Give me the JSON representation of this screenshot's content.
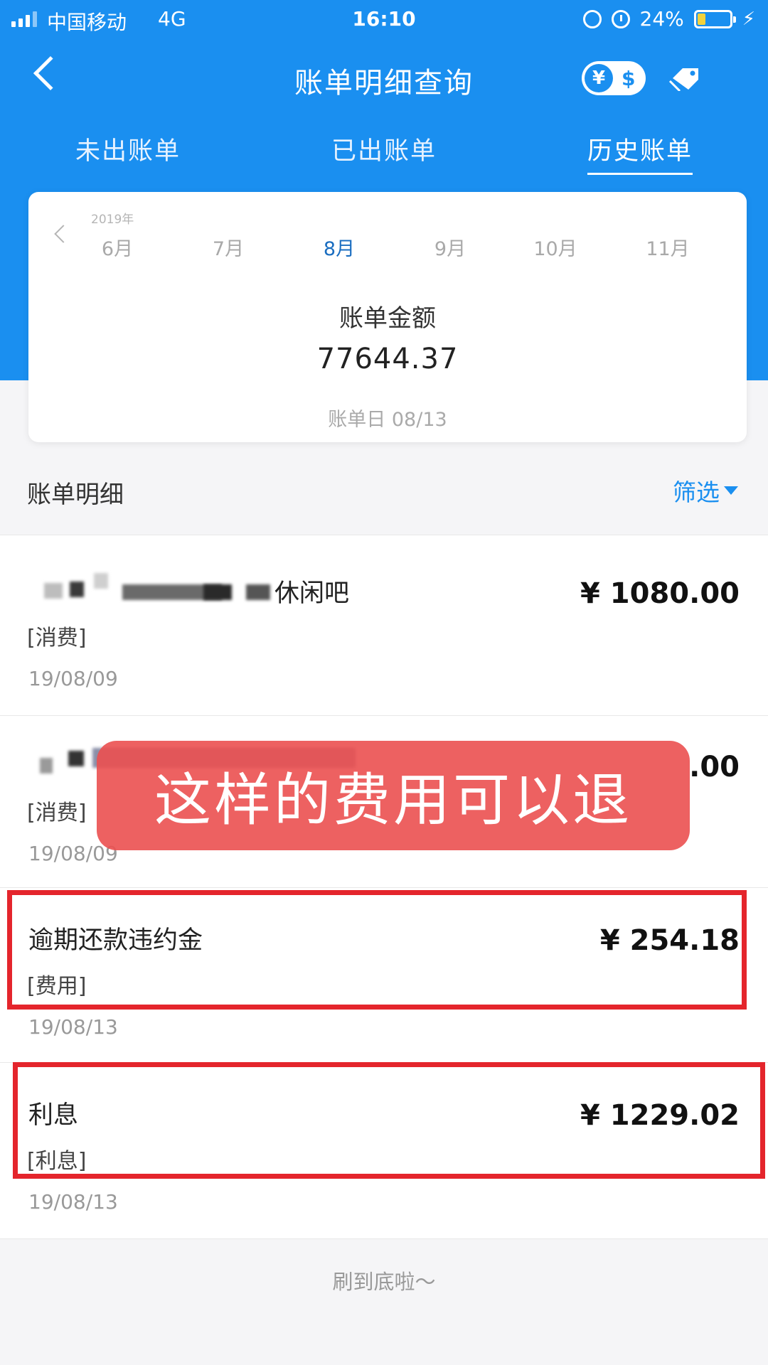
{
  "status_bar": {
    "carrier": "中国移动",
    "network": "4G",
    "time": "16:10",
    "battery": "24%"
  },
  "nav": {
    "title": "账单明细查询",
    "currency_yen": "¥",
    "currency_dollar": "$"
  },
  "tabs": [
    {
      "label": "未出账单",
      "active": false
    },
    {
      "label": "已出账单",
      "active": false
    },
    {
      "label": "历史账单",
      "active": true
    }
  ],
  "summary": {
    "year": "2019年",
    "months": [
      "6月",
      "7月",
      "8月",
      "9月",
      "10月",
      "11月"
    ],
    "selected_month": "8月",
    "label": "账单金额",
    "amount": "77644.37",
    "bill_date": "账单日 08/13"
  },
  "details": {
    "title": "账单明细",
    "filter_label": "筛选"
  },
  "transactions": [
    {
      "title": "休闲吧",
      "type": "[消费]",
      "date": "19/08/09",
      "amount": "¥ 1080.00"
    },
    {
      "title": "",
      "type": "[消费]",
      "date": "19/08/09",
      "amount": ".00"
    },
    {
      "title": "逾期还款违约金",
      "type": "[费用]",
      "date": "19/08/13",
      "amount": "¥ 254.18"
    },
    {
      "title": "利息",
      "type": "[利息]",
      "date": "19/08/13",
      "amount": "¥ 1229.02"
    }
  ],
  "overlay": {
    "text": "这样的费用可以退"
  },
  "footer": {
    "text": "刷到底啦～"
  },
  "colors": {
    "header_blue": "#1a8ff0",
    "highlight_red": "#e4252c",
    "banner_red": "#eb5050"
  }
}
